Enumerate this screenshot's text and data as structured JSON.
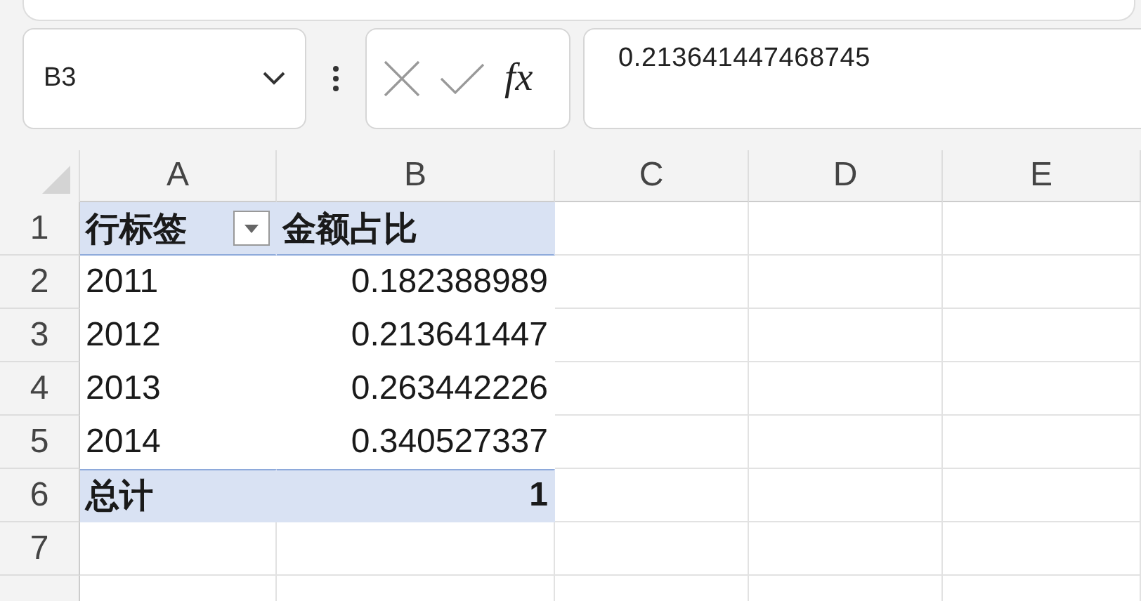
{
  "name_box": {
    "value": "B3"
  },
  "formula_bar": {
    "function_label": "fx",
    "value": "0.213641447468745"
  },
  "columns": [
    "A",
    "B",
    "C",
    "D",
    "E"
  ],
  "rows": [
    {
      "number": "1",
      "kind": "header",
      "cells": [
        "行标签",
        "金额占比"
      ],
      "filter": true
    },
    {
      "number": "2",
      "kind": "data",
      "cells": [
        "2011",
        "0.182388989"
      ]
    },
    {
      "number": "3",
      "kind": "data",
      "cells": [
        "2012",
        "0.213641447"
      ]
    },
    {
      "number": "4",
      "kind": "data",
      "cells": [
        "2013",
        "0.263442226"
      ]
    },
    {
      "number": "5",
      "kind": "data",
      "cells": [
        "2014",
        "0.340527337"
      ]
    },
    {
      "number": "6",
      "kind": "total",
      "cells": [
        "总计",
        "1"
      ]
    },
    {
      "number": "7",
      "kind": "empty"
    }
  ]
}
